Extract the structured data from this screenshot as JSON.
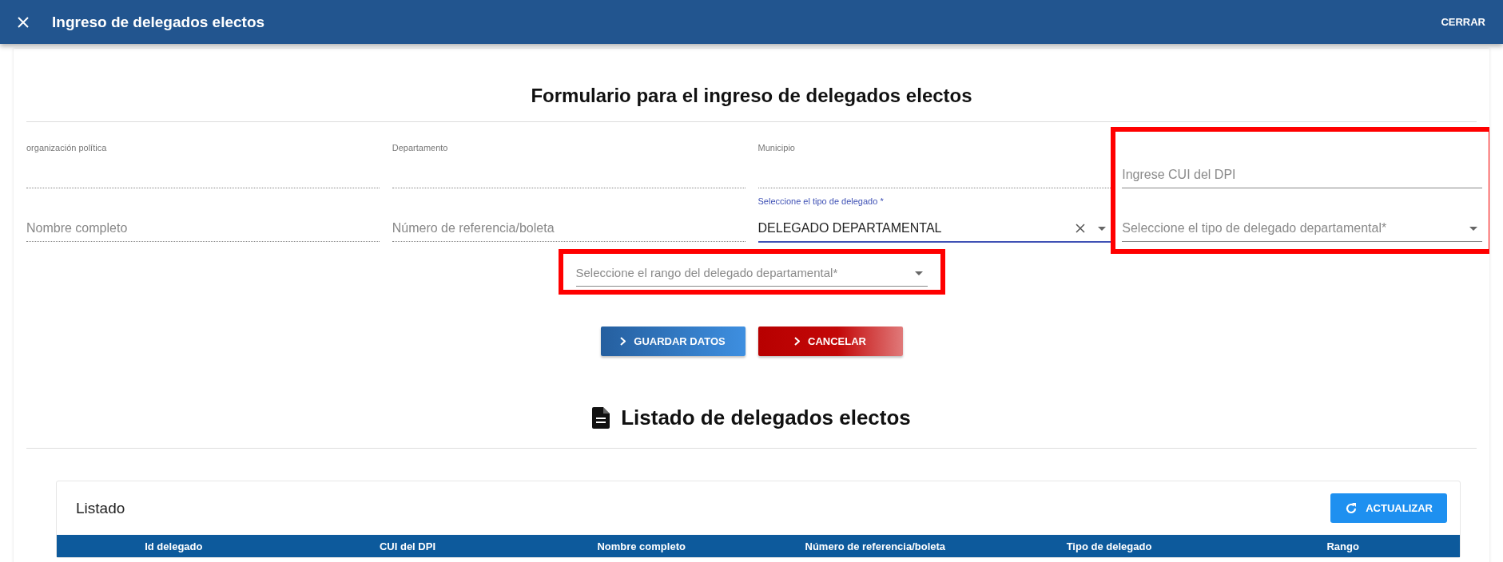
{
  "header": {
    "title": "Ingreso de delegados electos",
    "close_action": "CERRAR"
  },
  "form": {
    "title": "Formulario para el ingreso de delegados electos",
    "columns": [
      {
        "highlighted": false,
        "fields": [
          {
            "kind": "text",
            "label": "organización política",
            "disabled": true
          },
          {
            "kind": "text",
            "placeholder": "Nombre completo",
            "disabled": true
          }
        ]
      },
      {
        "highlighted": false,
        "fields": [
          {
            "kind": "text",
            "label": "Departamento",
            "disabled": true
          },
          {
            "kind": "text",
            "placeholder": "Número de referencia/boleta",
            "disabled": true
          }
        ]
      },
      {
        "highlighted": false,
        "fields": [
          {
            "kind": "text",
            "label": "Municipio",
            "disabled": true
          },
          {
            "kind": "select",
            "label": "Seleccione el tipo de delegado *",
            "value": "DELEGADO DEPARTAMENTAL",
            "focused": true,
            "clearable": true,
            "disabled": false
          }
        ]
      },
      {
        "highlighted": true,
        "fields": [
          {
            "kind": "text",
            "placeholder": "Ingrese CUI del DPI",
            "disabled": false
          },
          {
            "kind": "select",
            "placeholder": "Seleccione el tipo de delegado departamental*",
            "disabled": false
          }
        ]
      }
    ],
    "rank_field": {
      "highlighted": true,
      "field": {
        "kind": "select",
        "placeholder": "Seleccione el rango del delegado departamental*",
        "disabled": false
      }
    },
    "buttons": [
      {
        "label": "GUARDAR DATOS",
        "kind": "primary"
      },
      {
        "label": "CANCELAR",
        "kind": "danger"
      }
    ]
  },
  "list": {
    "title": "Listado de delegados electos",
    "card_title": "Listado",
    "refresh_button": "ACTUALIZAR",
    "columns": [
      "Id delegado",
      "CUI del DPI",
      "Nombre completo",
      "Número de referencia/boleta",
      "Tipo de delegado",
      "Rango"
    ]
  }
}
